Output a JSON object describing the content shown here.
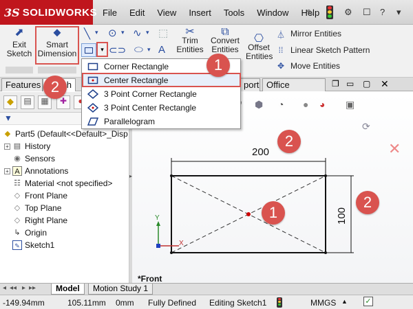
{
  "app": {
    "logo_mark": "3S",
    "logo_text": "SOLIDWORKS"
  },
  "menu": [
    "File",
    "Edit",
    "View",
    "Insert",
    "Tools",
    "Window",
    "Help"
  ],
  "toolbar": {
    "exit_sketch": "Exit Sketch",
    "smart_dimension": "Smart Dimension",
    "trim_entities": "Trim Entities",
    "convert_entities": "Convert Entities",
    "offset_entities": "Offset Entities",
    "mirror_entities": "Mirror Entities",
    "linear_sketch_pattern": "Linear Sketch Pattern",
    "move_entities": "Move Entities"
  },
  "tabs": {
    "features": "Features",
    "sketch_fragment": "ch",
    "export_fragment": "port",
    "office_products": "Office Products"
  },
  "rectangle_menu": {
    "items": [
      "Corner Rectangle",
      "Center Rectangle",
      "3 Point Corner Rectangle",
      "3 Point Center Rectangle",
      "Parallelogram"
    ],
    "selected": "Center Rectangle"
  },
  "tree": {
    "root": "Part5  (Default<<Default>_Disp",
    "items": [
      "History",
      "Sensors",
      "Annotations",
      "Material <not specified>",
      "Front Plane",
      "Top Plane",
      "Right Plane",
      "Origin",
      "Sketch1"
    ]
  },
  "graphics": {
    "dim_width": "200",
    "dim_height": "100",
    "view_label": "*Front",
    "axis_x": "X",
    "axis_y": "Y"
  },
  "callouts": {
    "one_a": "1",
    "one_b": "1",
    "two_a": "2",
    "two_b": "2",
    "two_c": "2"
  },
  "bottom_tabs": {
    "model": "Model",
    "motion": "Motion Study 1"
  },
  "status": {
    "x": "-149.94mm",
    "y": "105.11mm",
    "z": "0mm",
    "state": "Fully Defined",
    "editing": "Editing Sketch1",
    "units": "MMGS"
  },
  "colors": {
    "brand_red": "#c0161d",
    "callout": "#d9534f",
    "sketch_blue": "#2b4ea0"
  }
}
